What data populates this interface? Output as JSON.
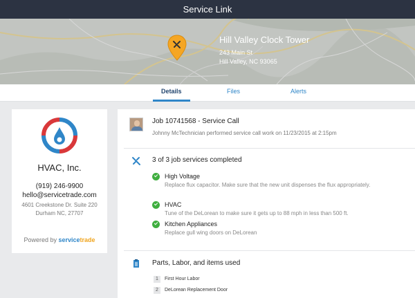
{
  "header": {
    "title": "Service Link"
  },
  "location": {
    "name": "Hill Valley Clock Tower",
    "street": "243 Main St",
    "city": "Hill Valley, NC 93065"
  },
  "tabs": [
    {
      "label": "Details",
      "active": true
    },
    {
      "label": "Files",
      "active": false
    },
    {
      "label": "Alerts",
      "active": false
    }
  ],
  "company": {
    "name": "HVAC, Inc.",
    "phone": "(919) 246-9900",
    "email": "hello@servicetrade.com",
    "address_line1": "4601 Creekstone Dr. Suite 220",
    "address_line2": "Durham NC, 27707",
    "powered_prefix": "Powered by",
    "brand_part1": "service",
    "brand_part2": "trade"
  },
  "job": {
    "title": "Job 10741568 - Service Call",
    "summary": "Johnny McTechnician performed service call work on 11/23/2015 at 2:15pm"
  },
  "services": {
    "heading": "3 of 3 job services completed",
    "items": [
      {
        "name": "High Voltage",
        "description": "Replace flux capacitor. Make sure that the new unit dispenses the flux appropriately."
      },
      {
        "name": "HVAC",
        "description": "Tune of the DeLorean to make sure it gets up to 88 mph in less than 500 ft."
      },
      {
        "name": "Kitchen Appliances",
        "description": "Replace gull wing doors on DeLorean"
      }
    ]
  },
  "parts": {
    "heading": "Parts, Labor, and items used",
    "items": [
      {
        "qty": "1",
        "name": "First Hour Labor"
      },
      {
        "qty": "2",
        "name": "DeLorean Replacement Door"
      }
    ]
  },
  "colors": {
    "topbar": "#2c3342",
    "accent": "#2f86c8",
    "check": "#3fae3f",
    "pin": "#f5a623"
  }
}
